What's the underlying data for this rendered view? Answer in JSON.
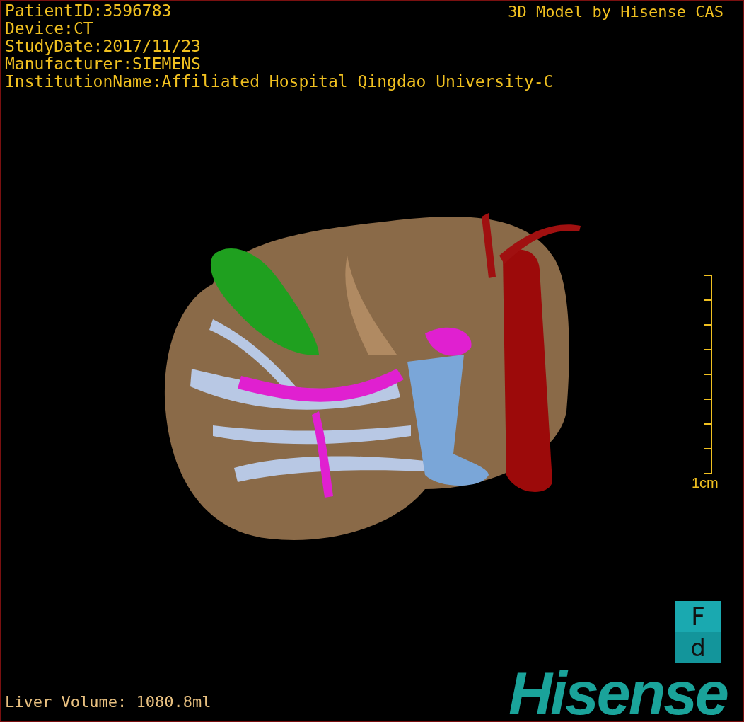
{
  "info_lines": [
    "PatientID:3596783",
    "Device:CT",
    "StudyDate:2017/11/23",
    "Manufacturer:SIEMENS",
    "InstitutionName:Affiliated Hospital Qingdao University-C"
  ],
  "credit": "3D Model by Hisense CAS",
  "scale_bar": {
    "label": "1cm"
  },
  "liver_volume": "Liver Volume: 1080.8ml",
  "logo_badge": {
    "top": "F",
    "bottom": "d"
  },
  "brand": "Hisense"
}
